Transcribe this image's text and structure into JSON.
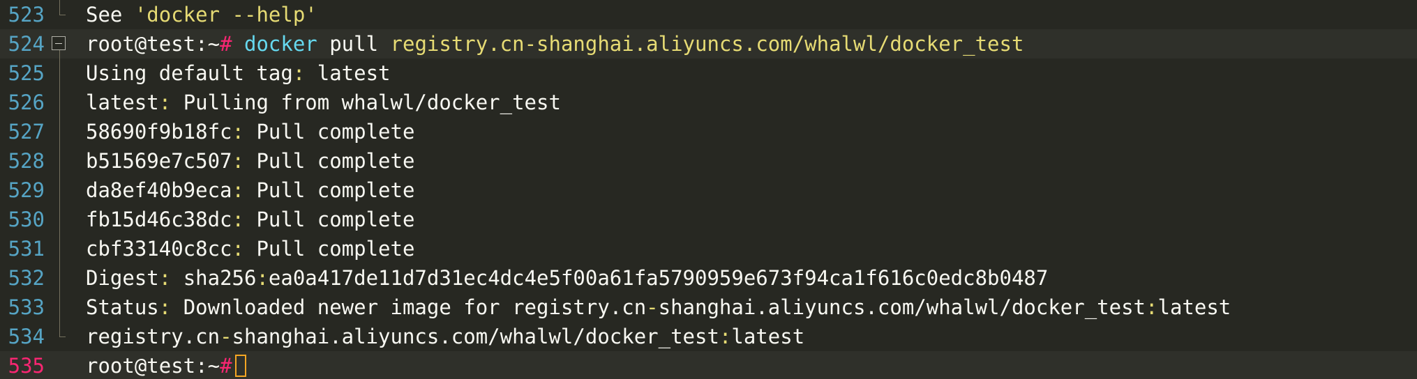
{
  "colors": {
    "background": "#272822",
    "line_number": "#56a4c4",
    "current_line_number": "#f92672",
    "string": "#e6db74",
    "command": "#66d9ef",
    "prompt_symbol": "#f92672",
    "cursor": "#f5a623"
  },
  "lines": [
    {
      "no": "523",
      "see": "See ",
      "arg": "'docker --help'"
    },
    {
      "no": "524",
      "user": "root@test:~",
      "hash": "#",
      "cmd": "docker",
      "sub": " pull ",
      "image": "registry.cn-shanghai.aliyuncs.com/whalwl/docker_test"
    },
    {
      "no": "525",
      "label": "Using default tag",
      "colon": ":",
      "value": " latest"
    },
    {
      "no": "526",
      "label": "latest",
      "colon": ":",
      "value": " Pulling from whalwl/docker_test"
    },
    {
      "no": "527",
      "label": "58690f9b18fc",
      "colon": ":",
      "value": " Pull complete"
    },
    {
      "no": "528",
      "label": "b51569e7c507",
      "colon": ":",
      "value": " Pull complete"
    },
    {
      "no": "529",
      "label": "da8ef40b9eca",
      "colon": ":",
      "value": " Pull complete"
    },
    {
      "no": "530",
      "label": "fb15d46c38dc",
      "colon": ":",
      "value": " Pull complete"
    },
    {
      "no": "531",
      "label": "cbf33140c8cc",
      "colon": ":",
      "value": " Pull complete"
    },
    {
      "no": "532",
      "label": "Digest",
      "colon": ":",
      "mid": " sha256",
      "colon2": ":",
      "value": "ea0a417de11d7d31ec4dc4e5f00a61fa5790959e673f94ca1f616c0edc8b0487"
    },
    {
      "no": "533",
      "label": "Status",
      "colon": ":",
      "mid": " Downloaded newer image for registry.cn",
      "dash": "-",
      "rest": "shanghai.aliyuncs.com/whalwl/docker_test",
      "colon2": ":",
      "value": "latest"
    },
    {
      "no": "534",
      "a": "registry.cn",
      "dash": "-",
      "b": "shanghai.aliyuncs.com/whalwl/docker_test",
      "colon": ":",
      "value": "latest"
    },
    {
      "no": "535",
      "user": "root@test:~",
      "hash": "#"
    }
  ]
}
